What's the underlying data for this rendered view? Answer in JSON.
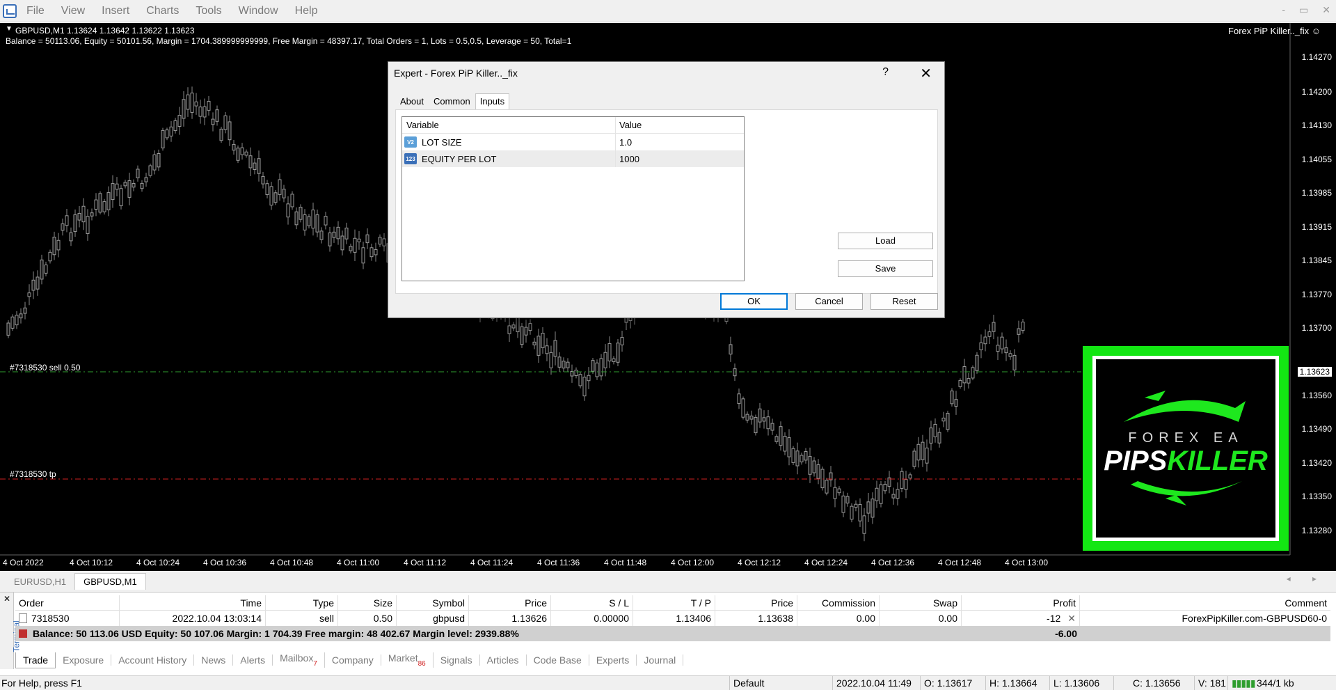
{
  "menubar": {
    "items": [
      "File",
      "View",
      "Insert",
      "Charts",
      "Tools",
      "Window",
      "Help"
    ],
    "window_controls": [
      "-",
      "▭",
      "✕"
    ]
  },
  "chart": {
    "symbol_line": "GBPUSD,M1  1.13624 1.13642 1.13622 1.13623",
    "account_line": "Balance = 50113.06, Equity = 50101.56, Margin = 1704.389999999999, Free Margin = 48397.17, Total Orders = 1, Lots = 0.5,0.5, Leverage = 50, Total=1",
    "expert_label": "Forex PiP Killer.._fix ☺",
    "price_ticks": [
      "1.14270",
      "1.14200",
      "1.14130",
      "1.14055",
      "1.13985",
      "1.13915",
      "1.13845",
      "1.13770",
      "1.13700",
      "1.13560",
      "1.13490",
      "1.13420",
      "1.13350",
      "1.13280"
    ],
    "current_price": "1.13623",
    "time_ticks": [
      "4 Oct 2022",
      "4 Oct 10:12",
      "4 Oct 10:24",
      "4 Oct 10:36",
      "4 Oct 10:48",
      "4 Oct 11:00",
      "4 Oct 11:12",
      "4 Oct 11:24",
      "4 Oct 11:36",
      "4 Oct 11:48",
      "4 Oct 12:00",
      "4 Oct 12:12",
      "4 Oct 12:24",
      "4 Oct 12:36",
      "4 Oct 12:48",
      "4 Oct 13:00"
    ],
    "sell_line_label": "#7318530 sell 0.50",
    "tp_line_label": "#7318530 tp",
    "colors": {
      "background": "#000000",
      "sell_line": "#2e9e2e",
      "tp_line": "#d02020",
      "candle": "#c0c0c0"
    },
    "logo": {
      "top_text": "FOREX EA",
      "main_white": "PIPS",
      "main_green": "KILLER",
      "color": "#13e613"
    }
  },
  "dialog": {
    "title": "Expert - Forex PiP Killer.._fix",
    "help": "?",
    "close": "✕",
    "tabs": [
      "About",
      "Common",
      "Inputs"
    ],
    "active_tab": "Inputs",
    "columns": [
      "Variable",
      "Value"
    ],
    "rows": [
      {
        "icon": "V2",
        "variable": "LOT SIZE",
        "value": "1.0"
      },
      {
        "icon": "123",
        "variable": "EQUITY PER LOT",
        "value": "1000"
      }
    ],
    "buttons": {
      "load": "Load",
      "save": "Save",
      "ok": "OK",
      "cancel": "Cancel",
      "reset": "Reset"
    }
  },
  "chart_tabs": {
    "tabs": [
      "EURUSD,H1",
      "GBPUSD,M1"
    ],
    "active": "GBPUSD,M1",
    "arrows": "◂ ▸"
  },
  "terminal": {
    "side_label": "Terminal",
    "close": "✕",
    "columns": [
      "Order",
      "Time",
      "Type",
      "Size",
      "Symbol",
      "Price",
      "S / L",
      "T / P",
      "Price",
      "Commission",
      "Swap",
      "Profit",
      "Comment"
    ],
    "order": {
      "order": "7318530",
      "time": "2022.10.04 13:03:14",
      "type": "sell",
      "size": "0.50",
      "symbol": "gbpusd",
      "price": "1.13626",
      "sl": "0.00000",
      "tp": "1.13406",
      "price_now": "1.13638",
      "commission": "0.00",
      "swap": "0.00",
      "profit": "-12",
      "close_x": "✕",
      "comment": "ForexPipKiller.com-GBPUSD60-0"
    },
    "balance_line": "Balance: 50 113.06 USD  Equity: 50 107.06  Margin: 1 704.39  Free margin: 48 402.67  Margin level: 2939.88%",
    "balance_profit": "-6.00",
    "tabs": [
      {
        "label": "Trade",
        "badge": ""
      },
      {
        "label": "Exposure",
        "badge": ""
      },
      {
        "label": "Account History",
        "badge": ""
      },
      {
        "label": "News",
        "badge": ""
      },
      {
        "label": "Alerts",
        "badge": ""
      },
      {
        "label": "Mailbox",
        "badge": "7"
      },
      {
        "label": "Company",
        "badge": ""
      },
      {
        "label": "Market",
        "badge": "86"
      },
      {
        "label": "Signals",
        "badge": ""
      },
      {
        "label": "Articles",
        "badge": ""
      },
      {
        "label": "Code Base",
        "badge": ""
      },
      {
        "label": "Experts",
        "badge": ""
      },
      {
        "label": "Journal",
        "badge": ""
      }
    ],
    "active_tab": "Trade"
  },
  "statusbar": {
    "help": "For Help, press F1",
    "profile": "Default",
    "datetime": "2022.10.04 11:49",
    "open": "O: 1.13617",
    "high": "H: 1.13664",
    "low": "L: 1.13606",
    "close": "C: 1.13656",
    "volume": "V: 181",
    "traffic": "344/1 kb"
  }
}
